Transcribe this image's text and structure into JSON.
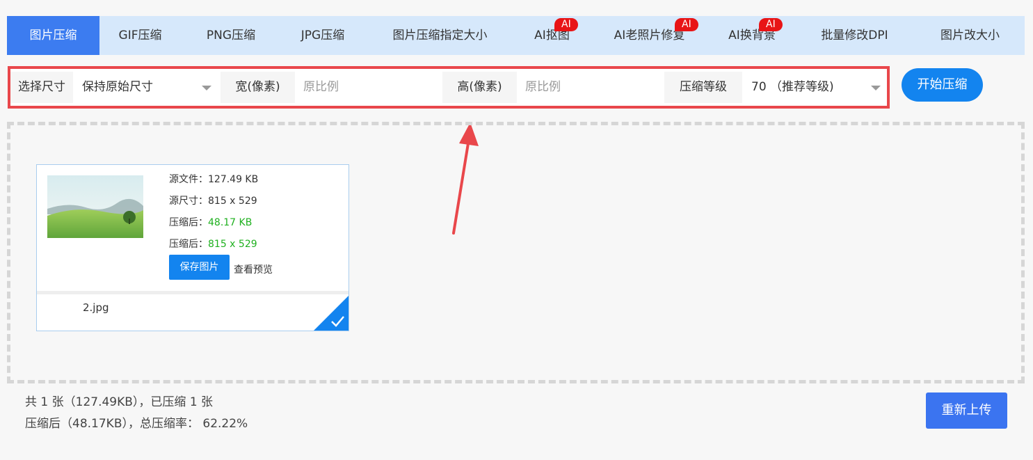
{
  "tabs": [
    {
      "label": "图片压缩",
      "ai": ""
    },
    {
      "label": "GIF压缩",
      "ai": ""
    },
    {
      "label": "PNG压缩",
      "ai": ""
    },
    {
      "label": "JPG压缩",
      "ai": ""
    },
    {
      "label": "图片压缩指定大小",
      "ai": ""
    },
    {
      "label": "AI抠图",
      "ai": "AI"
    },
    {
      "label": "AI老照片修复",
      "ai": "AI"
    },
    {
      "label": "AI换背景",
      "ai": "AI"
    },
    {
      "label": "批量修改DPI",
      "ai": ""
    },
    {
      "label": "图片改大小",
      "ai": ""
    }
  ],
  "options": {
    "size_label": "选择尺寸",
    "size_value": "保持原始尺寸",
    "width_label": "宽(像素)",
    "width_placeholder": "原比例",
    "height_label": "高(像素)",
    "height_placeholder": "原比例",
    "level_label": "压缩等级",
    "level_value": "70 （推荐等级)"
  },
  "start_button": "开始压缩",
  "file_card": {
    "source_file_label": "源文件：",
    "source_file_value": "127.49 KB",
    "source_size_label": "源尺寸：",
    "source_size_value": "815 x 529",
    "compressed_label": "压缩后：",
    "compressed_value": "48.17 KB",
    "compressed_size_label": "压缩后：",
    "compressed_size_value": "815 x 529",
    "save_button": "保存图片",
    "preview_link": "查看预览",
    "file_name": "2.jpg"
  },
  "summary": {
    "line1": "共 1 张（127.49KB），已压缩 1 张",
    "line2": "压缩后（48.17KB），总压缩率： 62.22%"
  },
  "reupload_button": "重新上传",
  "colors": {
    "accent": "#1384ef",
    "tab_active": "#3c7cf0",
    "highlight_border": "#e9474b",
    "success_green": "#1fb01f",
    "ai_badge": "#e81416"
  }
}
